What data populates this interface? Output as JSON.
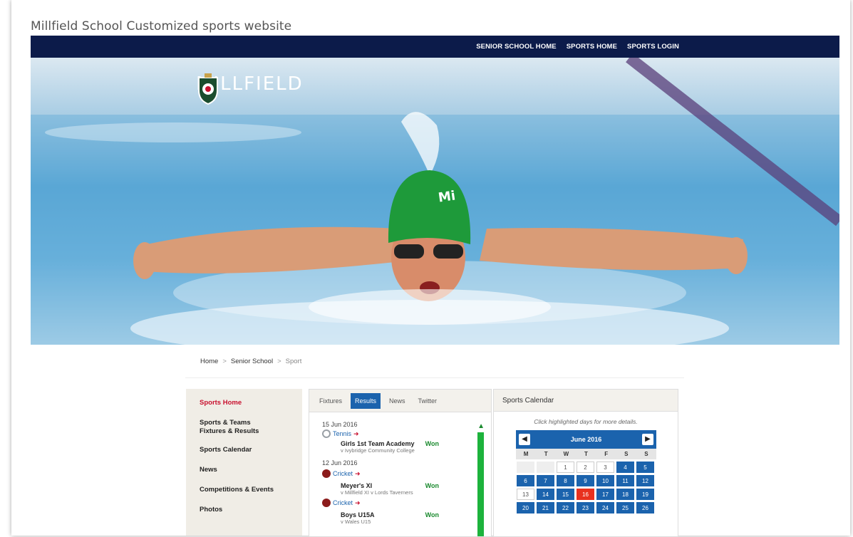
{
  "caption": "Millfield School Customized sports website",
  "topnav": [
    "SENIOR SCHOOL HOME",
    "SPORTS HOME",
    "SPORTS LOGIN"
  ],
  "hero": {
    "logo_text": "MILLFIELD",
    "cap_text": "Mi"
  },
  "breadcrumb": {
    "home": "Home",
    "sep": ">",
    "senior": "Senior School",
    "sport": "Sport"
  },
  "sidenav": [
    "Sports Home",
    "Sports & Teams Fixtures & Results",
    "Sports Calendar",
    "News",
    "Competitions & Events",
    "Photos"
  ],
  "results": {
    "tabs": [
      "Fixtures",
      "Results",
      "News",
      "Twitter"
    ],
    "active_tab": "Results",
    "items": [
      {
        "date": "15 Jun 2016",
        "sport": "Tennis",
        "team": "Girls 1st Team Academy",
        "result": "Won",
        "opponent": "v Ivybridge Community College"
      },
      {
        "date": "12 Jun 2016",
        "sport": "Cricket",
        "team": "Meyer's XI",
        "result": "Won",
        "opponent": "v Millfield XI v Lords Taverners"
      },
      {
        "date": "",
        "sport": "Cricket",
        "team": "Boys U15A",
        "result": "Won",
        "opponent": "v Wales U15"
      }
    ]
  },
  "calendar": {
    "title": "Sports Calendar",
    "note": "Click highlighted days for more details.",
    "month": "June 2016",
    "prev": "◀",
    "next": "▶",
    "dow": [
      "M",
      "T",
      "W",
      "T",
      "F",
      "S",
      "S"
    ],
    "days": [
      "",
      "",
      "1",
      "2",
      "3",
      "4",
      "5",
      "6",
      "7",
      "8",
      "9",
      "10",
      "11",
      "12",
      "13",
      "14",
      "15",
      "16",
      "17",
      "18",
      "19",
      "20",
      "21",
      "22",
      "23",
      "24",
      "25",
      "26"
    ],
    "highlighted": [
      "4",
      "5",
      "6",
      "7",
      "8",
      "9",
      "10",
      "11",
      "12",
      "14",
      "15",
      "17",
      "18",
      "19",
      "20",
      "21",
      "22",
      "23",
      "24",
      "25",
      "26"
    ],
    "today": "16"
  },
  "colors": {
    "navy": "#0c1b4a",
    "accent_blue": "#1b63ad",
    "red": "#c8102e",
    "won_green": "#1a8a2e"
  }
}
